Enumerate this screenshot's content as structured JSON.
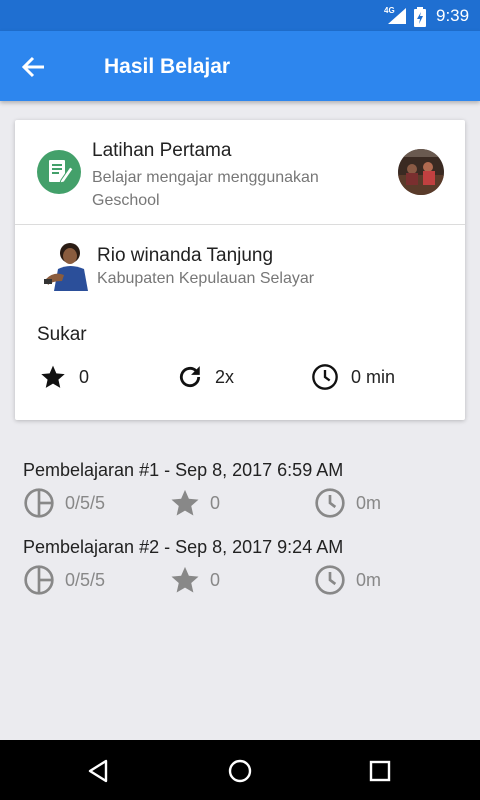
{
  "status_bar": {
    "network": "4G",
    "time": "9:39"
  },
  "app_bar": {
    "title": "Hasil Belajar",
    "back_icon": "arrow-left-icon"
  },
  "course": {
    "title": "Latihan Pertama",
    "description": "Belajar mengajar menggunakan Geschool",
    "icon": "document-edit-icon"
  },
  "user": {
    "name": "Rio winanda Tanjung",
    "region": "Kabupaten Kepulauan Selayar"
  },
  "summary": {
    "level": "Sukar",
    "stars": "0",
    "attempts": "2x",
    "duration": "0 min"
  },
  "sessions": [
    {
      "title": "Pembelajaran #1 - Sep 8, 2017 6:59 AM",
      "score": "0/5/5",
      "stars": "0",
      "time": "0m"
    },
    {
      "title": "Pembelajaran #2 - Sep 8, 2017 9:24 AM",
      "score": "0/5/5",
      "stars": "0",
      "time": "0m"
    }
  ],
  "colors": {
    "status_bar": "#1f6fd1",
    "app_bar": "#2d86ee",
    "background": "#ebebef"
  }
}
